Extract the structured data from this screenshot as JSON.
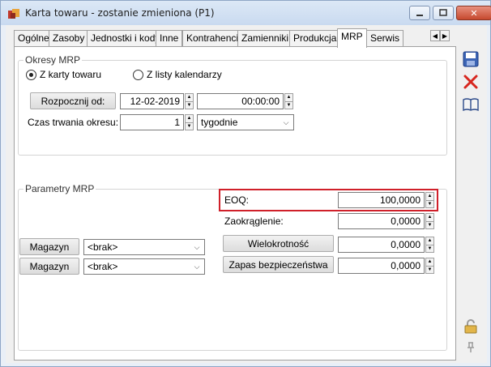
{
  "window": {
    "title": "Karta towaru - zostanie zmieniona (P1)",
    "minimize_icon": "minimize-icon",
    "maximize_icon": "maximize-icon",
    "close_label": "✕"
  },
  "tabs": [
    {
      "label": "Ogólne"
    },
    {
      "label": "Zasoby"
    },
    {
      "label": "Jednostki i kody"
    },
    {
      "label": "Inne"
    },
    {
      "label": "Kontrahenci"
    },
    {
      "label": "Zamienniki"
    },
    {
      "label": "Produkcja"
    },
    {
      "label": "MRP",
      "active": true
    },
    {
      "label": "Serwis"
    }
  ],
  "okresy": {
    "group_label": "Okresy MRP",
    "radio_karta": "Z karty towaru",
    "radio_listy": "Z listy kalendarzy",
    "selected": "Z karty towaru",
    "start_button": "Rozpocznij od:",
    "start_date": "12-02-2019",
    "start_time": "00:00:00",
    "duration_label": "Czas trwania okresu:",
    "duration_value": "1",
    "duration_unit": "tygodnie"
  },
  "parametry": {
    "group_label": "Parametry MRP",
    "eoq_label": "EOQ:",
    "eoq_value": "100,0000",
    "zaokr_label": "Zaokrąglenie:",
    "zaokr_value": "0,0000",
    "magazyn1_button": "Magazyn",
    "magazyn1_value": "<brak>",
    "magazyn2_button": "Magazyn",
    "magazyn2_value": "<brak>",
    "wielokrotnosc_button": "Wielokrotność",
    "wielokrotnosc_value": "0,0000",
    "zapas_button": "Zapas bezpieczeństwa",
    "zapas_value": "0,0000"
  },
  "toolbar": {
    "save_icon": "save-icon",
    "cancel_icon": "cancel-icon",
    "help_icon": "book-icon",
    "lock_icon": "padlock-icon",
    "pin_icon": "pin-icon"
  },
  "colors": {
    "highlight": "#d0202a",
    "accent": "#3c64b4"
  }
}
